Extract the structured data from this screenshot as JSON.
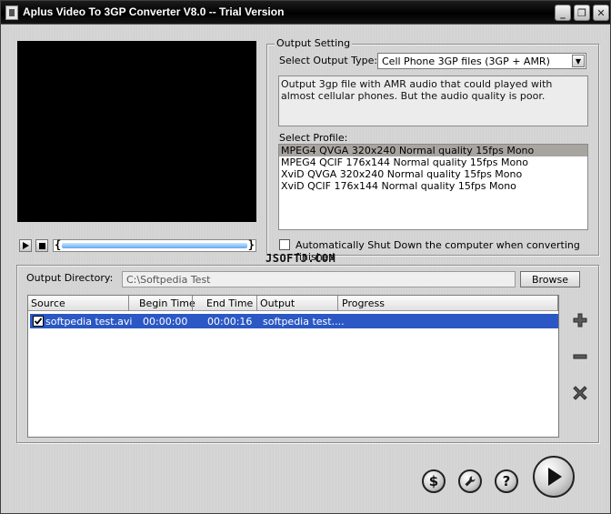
{
  "window": {
    "title": "Aplus Video To 3GP Converter V8.0 -- Trial Version",
    "minimize_glyph": "_",
    "restore_glyph": "❐",
    "close_glyph": "✕"
  },
  "output_setting": {
    "legend": "Output Setting",
    "type_label": "Select Output Type:",
    "type_value": "Cell Phone 3GP  files (3GP + AMR)",
    "description": "Output 3gp file with AMR audio that could played with almost cellular phones. But the audio quality is poor.",
    "profile_label": "Select Profile:",
    "profiles": [
      "MPEG4 QVGA 320x240 Normal quality 15fps Mono",
      "MPEG4 QCIF 176x144 Normal quality 15fps Mono",
      "XviD  QVGA 320x240 Normal quality 15fps Mono",
      "XviD  QCIF 176x144 Normal quality 15fps Mono"
    ],
    "selected_profile_index": 0,
    "shutdown_label": "Automatically Shut Down the computer when converting finished",
    "shutdown_checked": false
  },
  "watermark": "JSOFTJ.COM",
  "output_dir": {
    "label": "Output Directory:",
    "value": "C:\\Softpedia Test",
    "browse_label": "Browse"
  },
  "file_table": {
    "columns": [
      "Source",
      "Begin Time",
      "End Time",
      "Output",
      "Progress"
    ],
    "rows": [
      {
        "checked": true,
        "source": "softpedia test.avi",
        "begin": "00:00:00",
        "end": "00:00:16",
        "output": "softpedia test....",
        "progress": ""
      }
    ]
  },
  "side_icons": [
    "plus-icon",
    "minus-icon",
    "remove-x-icon"
  ],
  "bottom_buttons": [
    {
      "name": "buy-button",
      "glyph": "$"
    },
    {
      "name": "options-button",
      "icon": "wrench-icon"
    },
    {
      "name": "help-button",
      "glyph": "?"
    },
    {
      "name": "convert-button",
      "icon": "play-icon"
    }
  ],
  "colors": {
    "title_bar": "#000000",
    "selection": "#2b58c4",
    "profile_selection": "#a8a4a0",
    "seek_fill": "#5fa7f2"
  }
}
